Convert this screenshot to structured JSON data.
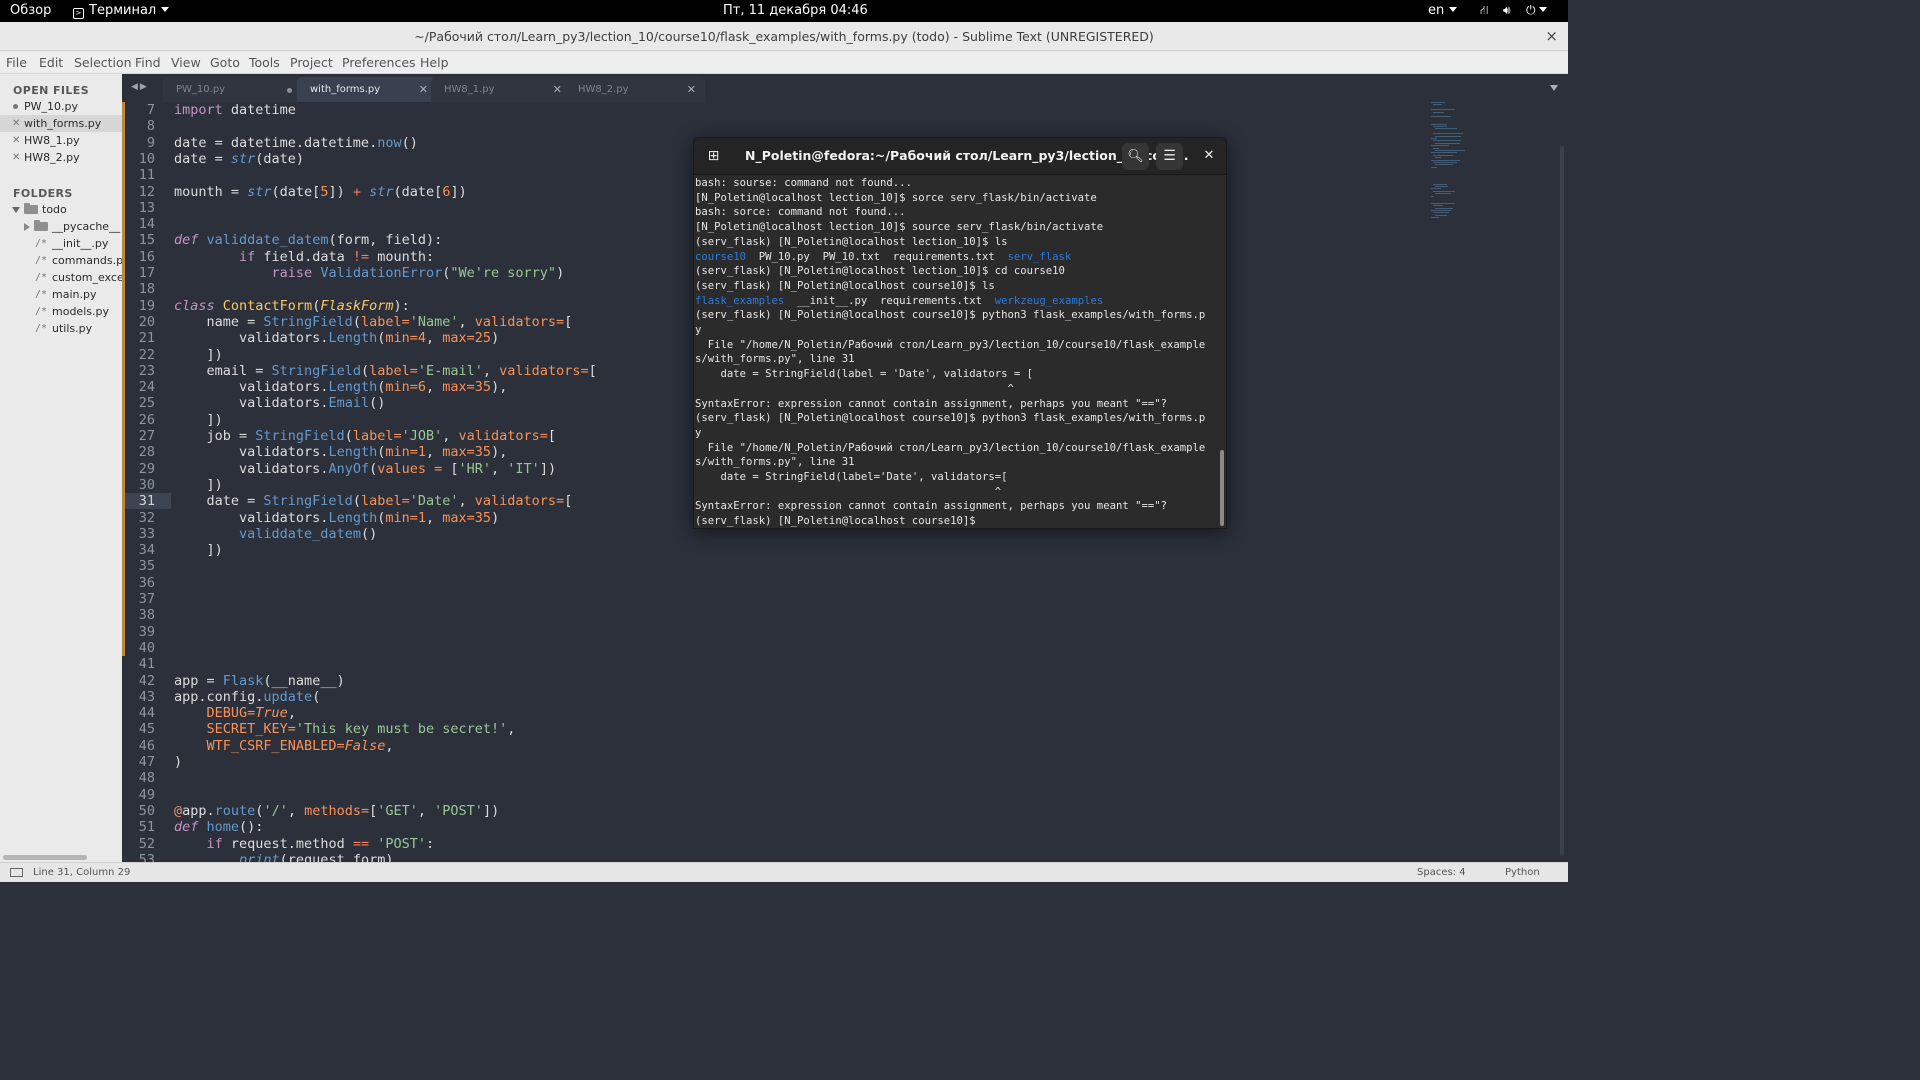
{
  "topbar": {
    "overview": "Обзор",
    "app_menu": "Терминал",
    "clock": "Пт, 11 декабря  04:46",
    "language": "en",
    "icons": [
      "network-icon",
      "volume-icon",
      "power-icon"
    ]
  },
  "window": {
    "title": "~/Рабочий стол/Learn_py3/lection_10/course10/flask_examples/with_forms.py (todo) - Sublime Text (UNREGISTERED)",
    "close": "×"
  },
  "menu": [
    "File",
    "Edit",
    "Selection",
    "Find",
    "View",
    "Goto",
    "Tools",
    "Project",
    "Preferences",
    "Help"
  ],
  "sidebar": {
    "open_files_header": "OPEN FILES",
    "open_files": [
      {
        "name": "PW_10.py",
        "marker": "dot"
      },
      {
        "name": "with_forms.py",
        "marker": "x"
      },
      {
        "name": "HW8_1.py",
        "marker": "x"
      },
      {
        "name": "HW8_2.py",
        "marker": "x"
      }
    ],
    "folders_header": "FOLDERS",
    "root_folder": "todo",
    "subfolder": "__pycache__",
    "files": [
      "__init__.py",
      "commands.py",
      "custom_excep",
      "main.py",
      "models.py",
      "utils.py"
    ]
  },
  "tabs": [
    {
      "label": "PW_10.py",
      "state": "modified"
    },
    {
      "label": "with_forms.py",
      "state": "active"
    },
    {
      "label": "HW8_1.py",
      "state": "normal"
    },
    {
      "label": "HW8_2.py",
      "state": "normal"
    }
  ],
  "editor": {
    "current_line": 31,
    "lines": [
      {
        "n": 7,
        "t": [
          [
            "kw",
            "import"
          ],
          [
            "p",
            " datetime"
          ]
        ]
      },
      {
        "n": 8,
        "t": []
      },
      {
        "n": 9,
        "t": [
          [
            "p",
            "date = datetime.datetime."
          ],
          [
            "fn",
            "now"
          ],
          [
            "p",
            "()"
          ]
        ]
      },
      {
        "n": 10,
        "t": [
          [
            "p",
            "date = "
          ],
          [
            "fni",
            "str"
          ],
          [
            "p",
            "(date)"
          ]
        ]
      },
      {
        "n": 11,
        "t": []
      },
      {
        "n": 12,
        "t": [
          [
            "p",
            "mounth = "
          ],
          [
            "fni",
            "str"
          ],
          [
            "p",
            "(date["
          ],
          [
            "num",
            "5"
          ],
          [
            "p",
            "]) "
          ],
          [
            "op",
            "+"
          ],
          [
            "p",
            " "
          ],
          [
            "fni",
            "str"
          ],
          [
            "p",
            "(date["
          ],
          [
            "num",
            "6"
          ],
          [
            "p",
            "])"
          ]
        ]
      },
      {
        "n": 13,
        "t": []
      },
      {
        "n": 14,
        "t": []
      },
      {
        "n": 15,
        "t": [
          [
            "kwi",
            "def"
          ],
          [
            "p",
            " "
          ],
          [
            "fn",
            "validdate_datem"
          ],
          [
            "p",
            "(form, field):"
          ]
        ]
      },
      {
        "n": 16,
        "t": [
          [
            "p",
            "        "
          ],
          [
            "kw",
            "if"
          ],
          [
            "p",
            " field.data "
          ],
          [
            "op",
            "!="
          ],
          [
            "p",
            " mounth:"
          ]
        ]
      },
      {
        "n": 17,
        "t": [
          [
            "p",
            "            "
          ],
          [
            "kw",
            "raise"
          ],
          [
            "p",
            " "
          ],
          [
            "fn",
            "ValidationError"
          ],
          [
            "p",
            "("
          ],
          [
            "str",
            "\"We're sorry\""
          ],
          [
            "p",
            ")"
          ]
        ]
      },
      {
        "n": 18,
        "t": []
      },
      {
        "n": 19,
        "t": [
          [
            "kwi",
            "class"
          ],
          [
            "p",
            " "
          ],
          [
            "cls",
            "ContactForm"
          ],
          [
            "p",
            "("
          ],
          [
            "ital",
            "FlaskForm"
          ],
          [
            "p",
            "):"
          ]
        ]
      },
      {
        "n": 20,
        "t": [
          [
            "p",
            "    name = "
          ],
          [
            "fn",
            "StringField"
          ],
          [
            "p",
            "("
          ],
          [
            "bi",
            "label="
          ],
          [
            "str",
            "'Name'"
          ],
          [
            "p",
            ", "
          ],
          [
            "bi",
            "validators="
          ],
          [
            "p",
            "["
          ]
        ]
      },
      {
        "n": 21,
        "t": [
          [
            "p",
            "        validators."
          ],
          [
            "fn",
            "Length"
          ],
          [
            "p",
            "("
          ],
          [
            "bi",
            "min="
          ],
          [
            "num",
            "4"
          ],
          [
            "p",
            ", "
          ],
          [
            "bi",
            "max="
          ],
          [
            "num",
            "25"
          ],
          [
            "p",
            ")"
          ]
        ]
      },
      {
        "n": 22,
        "t": [
          [
            "p",
            "    ])"
          ]
        ]
      },
      {
        "n": 23,
        "t": [
          [
            "p",
            "    email = "
          ],
          [
            "fn",
            "StringField"
          ],
          [
            "p",
            "("
          ],
          [
            "bi",
            "label="
          ],
          [
            "str",
            "'E-mail'"
          ],
          [
            "p",
            ", "
          ],
          [
            "bi",
            "validators="
          ],
          [
            "p",
            "["
          ]
        ]
      },
      {
        "n": 24,
        "t": [
          [
            "p",
            "        validators."
          ],
          [
            "fn",
            "Length"
          ],
          [
            "p",
            "("
          ],
          [
            "bi",
            "min="
          ],
          [
            "num",
            "6"
          ],
          [
            "p",
            ", "
          ],
          [
            "bi",
            "max="
          ],
          [
            "num",
            "35"
          ],
          [
            "p",
            "),"
          ]
        ]
      },
      {
        "n": 25,
        "t": [
          [
            "p",
            "        validators."
          ],
          [
            "fn",
            "Email"
          ],
          [
            "p",
            "()"
          ]
        ]
      },
      {
        "n": 26,
        "t": [
          [
            "p",
            "    ])"
          ]
        ]
      },
      {
        "n": 27,
        "t": [
          [
            "p",
            "    job = "
          ],
          [
            "fn",
            "StringField"
          ],
          [
            "p",
            "("
          ],
          [
            "bi",
            "label="
          ],
          [
            "str",
            "'JOB'"
          ],
          [
            "p",
            ", "
          ],
          [
            "bi",
            "validators="
          ],
          [
            "p",
            "["
          ]
        ]
      },
      {
        "n": 28,
        "t": [
          [
            "p",
            "        validators."
          ],
          [
            "fn",
            "Length"
          ],
          [
            "p",
            "("
          ],
          [
            "bi",
            "min="
          ],
          [
            "num",
            "1"
          ],
          [
            "p",
            ", "
          ],
          [
            "bi",
            "max="
          ],
          [
            "num",
            "35"
          ],
          [
            "p",
            "),"
          ]
        ]
      },
      {
        "n": 29,
        "t": [
          [
            "p",
            "        validators."
          ],
          [
            "fn",
            "AnyOf"
          ],
          [
            "p",
            "("
          ],
          [
            "bi",
            "values = "
          ],
          [
            "p",
            "["
          ],
          [
            "str",
            "'HR'"
          ],
          [
            "p",
            ", "
          ],
          [
            "str",
            "'IT'"
          ],
          [
            "p",
            "])"
          ]
        ]
      },
      {
        "n": 30,
        "t": [
          [
            "p",
            "    ])"
          ]
        ]
      },
      {
        "n": 31,
        "t": [
          [
            "p",
            "    date = "
          ],
          [
            "fn",
            "StringField"
          ],
          [
            "p",
            "("
          ],
          [
            "bi",
            "label="
          ],
          [
            "str",
            "'Date'"
          ],
          [
            "p",
            ", "
          ],
          [
            "bi",
            "validators="
          ],
          [
            "p",
            "["
          ]
        ]
      },
      {
        "n": 32,
        "t": [
          [
            "p",
            "        validators."
          ],
          [
            "fn",
            "Length"
          ],
          [
            "p",
            "("
          ],
          [
            "bi",
            "min="
          ],
          [
            "num",
            "1"
          ],
          [
            "p",
            ", "
          ],
          [
            "bi",
            "max="
          ],
          [
            "num",
            "35"
          ],
          [
            "p",
            ")"
          ]
        ]
      },
      {
        "n": 33,
        "t": [
          [
            "p",
            "        "
          ],
          [
            "fn",
            "validdate_datem"
          ],
          [
            "p",
            "()"
          ]
        ]
      },
      {
        "n": 34,
        "t": [
          [
            "p",
            "    ])"
          ]
        ]
      },
      {
        "n": 35,
        "t": []
      },
      {
        "n": 36,
        "t": []
      },
      {
        "n": 37,
        "t": []
      },
      {
        "n": 38,
        "t": []
      },
      {
        "n": 39,
        "t": []
      },
      {
        "n": 40,
        "t": []
      },
      {
        "n": 41,
        "t": []
      },
      {
        "n": 42,
        "t": [
          [
            "p",
            "app = "
          ],
          [
            "fn",
            "Flask"
          ],
          [
            "p",
            "(__name__)"
          ]
        ]
      },
      {
        "n": 43,
        "t": [
          [
            "p",
            "app.config."
          ],
          [
            "fn",
            "update"
          ],
          [
            "p",
            "("
          ]
        ]
      },
      {
        "n": 44,
        "t": [
          [
            "p",
            "    "
          ],
          [
            "bi",
            "DEBUG="
          ],
          [
            "bii",
            "True"
          ],
          [
            "p",
            ","
          ]
        ]
      },
      {
        "n": 45,
        "t": [
          [
            "p",
            "    "
          ],
          [
            "bi",
            "SECRET_KEY="
          ],
          [
            "str",
            "'This key must be secret!'"
          ],
          [
            "p",
            ","
          ]
        ]
      },
      {
        "n": 46,
        "t": [
          [
            "p",
            "    "
          ],
          [
            "bi",
            "WTF_CSRF_ENABLED="
          ],
          [
            "bii",
            "False"
          ],
          [
            "p",
            ","
          ]
        ]
      },
      {
        "n": 47,
        "t": [
          [
            "p",
            ")"
          ]
        ]
      },
      {
        "n": 48,
        "t": []
      },
      {
        "n": 49,
        "t": []
      },
      {
        "n": 50,
        "t": [
          [
            "dec",
            "@"
          ],
          [
            "p",
            "app."
          ],
          [
            "fn",
            "route"
          ],
          [
            "p",
            "("
          ],
          [
            "str",
            "'/'"
          ],
          [
            "p",
            ", "
          ],
          [
            "bi",
            "methods="
          ],
          [
            "p",
            "["
          ],
          [
            "str",
            "'GET'"
          ],
          [
            "p",
            ", "
          ],
          [
            "str",
            "'POST'"
          ],
          [
            "p",
            "])"
          ]
        ]
      },
      {
        "n": 51,
        "t": [
          [
            "kwi",
            "def"
          ],
          [
            "p",
            " "
          ],
          [
            "fn",
            "home"
          ],
          [
            "p",
            "():"
          ]
        ]
      },
      {
        "n": 52,
        "t": [
          [
            "p",
            "    "
          ],
          [
            "kw",
            "if"
          ],
          [
            "p",
            " request.method "
          ],
          [
            "op",
            "=="
          ],
          [
            "p",
            " "
          ],
          [
            "str",
            "'POST'"
          ],
          [
            "p",
            ":"
          ]
        ]
      },
      {
        "n": 53,
        "t": [
          [
            "p",
            "        "
          ],
          [
            "fni",
            "print"
          ],
          [
            "p",
            "(request.form)"
          ]
        ]
      }
    ]
  },
  "terminal": {
    "title": "N_Poletin@fedora:~/Рабочий стол/Learn_py3/lection_10/cour...",
    "lines": [
      [
        [
          "n",
          "bash: sourse: command not found..."
        ]
      ],
      [
        [
          "n",
          "[N_Poletin@localhost lection_10]$ sorce serv_flask/bin/activate"
        ]
      ],
      [
        [
          "n",
          "bash: sorce: command not found..."
        ]
      ],
      [
        [
          "n",
          "[N_Poletin@localhost lection_10]$ source serv_flask/bin/activate"
        ]
      ],
      [
        [
          "n",
          "(serv_flask) [N_Poletin@localhost lection_10]$ ls"
        ]
      ],
      [
        [
          "d",
          "course10"
        ],
        [
          "n",
          "  PW_10.py  PW_10.txt  requirements.txt  "
        ],
        [
          "d",
          "serv_flask"
        ]
      ],
      [
        [
          "n",
          "(serv_flask) [N_Poletin@localhost lection_10]$ cd course10"
        ]
      ],
      [
        [
          "n",
          "(serv_flask) [N_Poletin@localhost course10]$ ls"
        ]
      ],
      [
        [
          "d",
          "flask_examples"
        ],
        [
          "n",
          "  __init__.py  requirements.txt  "
        ],
        [
          "d",
          "werkzeug_examples"
        ]
      ],
      [
        [
          "n",
          "(serv_flask) [N_Poletin@localhost course10]$ python3 flask_examples/with_forms.p"
        ]
      ],
      [
        [
          "n",
          "y"
        ]
      ],
      [
        [
          "n",
          "  File \"/home/N_Poletin/Рабочий стол/Learn_py3/lection_10/course10/flask_example"
        ]
      ],
      [
        [
          "n",
          "s/with_forms.py\", line 31"
        ]
      ],
      [
        [
          "n",
          "    date = StringField(label = 'Date', validators = ["
        ]
      ],
      [
        [
          "n",
          "                                                 ^"
        ]
      ],
      [
        [
          "n",
          "SyntaxError: expression cannot contain assignment, perhaps you meant \"==\"?"
        ]
      ],
      [
        [
          "n",
          "(serv_flask) [N_Poletin@localhost course10]$ python3 flask_examples/with_forms.p"
        ]
      ],
      [
        [
          "n",
          "y"
        ]
      ],
      [
        [
          "n",
          "  File \"/home/N_Poletin/Рабочий стол/Learn_py3/lection_10/course10/flask_example"
        ]
      ],
      [
        [
          "n",
          "s/with_forms.py\", line 31"
        ]
      ],
      [
        [
          "n",
          "    date = StringField(label='Date', validators=["
        ]
      ],
      [
        [
          "n",
          "                                               ^"
        ]
      ],
      [
        [
          "n",
          "SyntaxError: expression cannot contain assignment, perhaps you meant \"==\"?"
        ]
      ],
      [
        [
          "n",
          "(serv_flask) [N_Poletin@localhost course10]$ "
        ]
      ]
    ]
  },
  "status": {
    "position": "Line 31, Column 29",
    "spaces": "Spaces: 4",
    "syntax": "Python"
  },
  "colors": {
    "editor_bg": "#2b303b",
    "terminal_bg": "#2b2b2b",
    "terminal_dir": "#2a7bde"
  }
}
